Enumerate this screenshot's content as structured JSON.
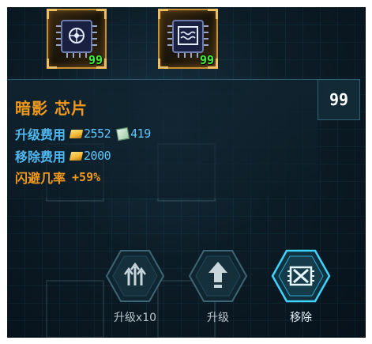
{
  "chips": [
    {
      "icon": "shadow-chip-icon",
      "count": "99"
    },
    {
      "icon": "wave-chip-icon",
      "count": "99"
    }
  ],
  "chip": {
    "name": "暗影 芯片",
    "level": "99",
    "upgrade_cost_label": "升级费用",
    "upgrade_gold": "2552",
    "upgrade_tiles": "419",
    "remove_cost_label": "移除费用",
    "remove_gold": "2000",
    "stat_label": "闪避几率",
    "stat_value": "+59%"
  },
  "actions": {
    "upgrade_x10": "升级x10",
    "upgrade": "升级",
    "remove": "移除"
  },
  "colors": {
    "accent_orange": "#f39a1c",
    "label_blue": "#4fb8f0",
    "count_green": "#3ef03a",
    "remove_glow": "#3fd3ff"
  }
}
